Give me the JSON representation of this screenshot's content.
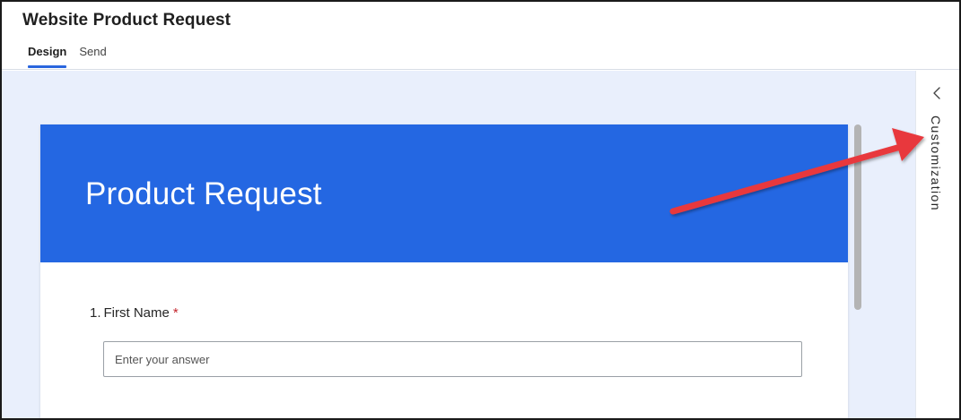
{
  "header": {
    "title": "Website Product Request",
    "tabs": [
      {
        "label": "Design",
        "active": true
      },
      {
        "label": "Send",
        "active": false
      }
    ]
  },
  "form": {
    "banner_title": "Product Request",
    "banner_color": "#2467e2",
    "questions": [
      {
        "number": "1.",
        "label": "First Name",
        "required_marker": "*",
        "placeholder": "Enter your answer"
      }
    ]
  },
  "side_panel": {
    "label": "Customization",
    "icon": "chevron-left-icon"
  },
  "annotation": {
    "type": "arrow",
    "color": "#e8383d",
    "points_to": "side_panel"
  },
  "colors": {
    "accent": "#2a66de",
    "canvas_bg": "#e9effc",
    "required": "#c4262e"
  }
}
